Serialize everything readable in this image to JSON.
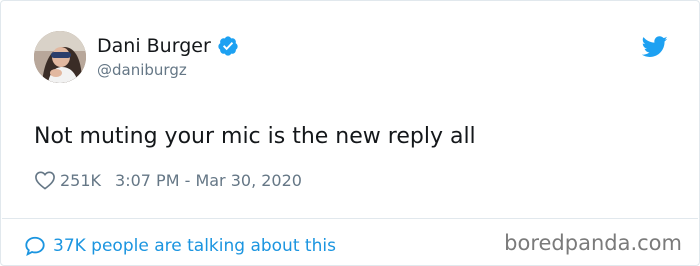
{
  "tweet": {
    "author": {
      "display_name": "Dani Burger",
      "handle": "@daniburgz",
      "verified": true
    },
    "text": "Not muting your mic is the new reply all",
    "likes": "251K",
    "timestamp": "3:07 PM - Mar 30, 2020",
    "conversation_link": "37K people are talking about this"
  },
  "watermark": "boredpanda.com",
  "icons": {
    "verified": "verified-badge-icon",
    "twitter": "twitter-bird-icon",
    "like": "heart-icon",
    "reply": "speech-bubble-icon"
  },
  "colors": {
    "accent": "#1da1f2",
    "link": "#1b95e0",
    "text": "#14171a",
    "muted": "#657786"
  }
}
